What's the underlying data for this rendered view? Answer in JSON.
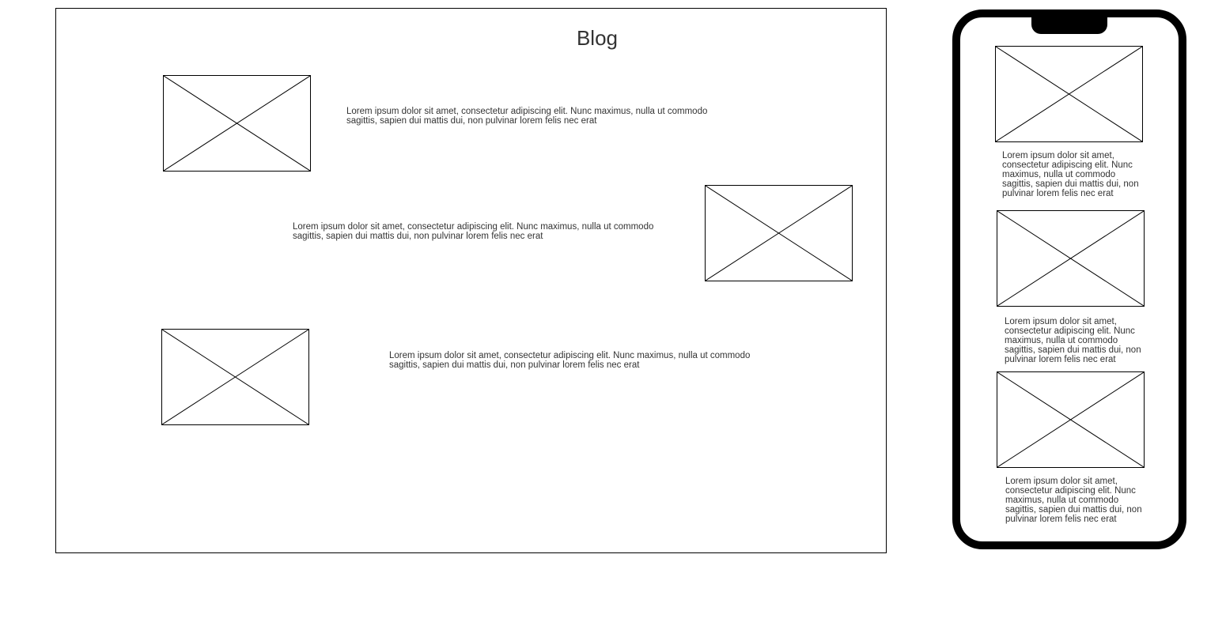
{
  "desktop": {
    "title": "Blog",
    "posts": [
      {
        "text": "Lorem ipsum dolor sit amet, consectetur adipiscing elit. Nunc maximus, nulla ut commodo sagittis, sapien dui mattis dui, non pulvinar lorem felis nec erat"
      },
      {
        "text": "Lorem ipsum dolor sit amet, consectetur adipiscing elit. Nunc maximus, nulla ut commodo sagittis, sapien dui mattis dui, non pulvinar lorem felis nec erat"
      },
      {
        "text": "Lorem ipsum dolor sit amet, consectetur adipiscing elit. Nunc maximus, nulla ut commodo sagittis, sapien dui mattis dui, non pulvinar lorem felis nec erat"
      }
    ]
  },
  "mobile": {
    "posts": [
      {
        "text": "Lorem ipsum dolor sit amet, consectetur adipiscing elit. Nunc maximus, nulla ut commodo sagittis, sapien dui mattis dui, non pulvinar lorem felis nec erat"
      },
      {
        "text": "Lorem ipsum dolor sit amet, consectetur adipiscing elit. Nunc maximus, nulla ut commodo sagittis, sapien dui mattis dui, non pulvinar lorem felis nec erat"
      },
      {
        "text": "Lorem ipsum dolor sit amet, consectetur adipiscing elit. Nunc maximus, nulla ut commodo sagittis, sapien dui mattis dui, non pulvinar lorem felis nec erat"
      }
    ]
  },
  "colors": {
    "stroke": "#000000",
    "text": "#333333",
    "background": "#ffffff"
  }
}
